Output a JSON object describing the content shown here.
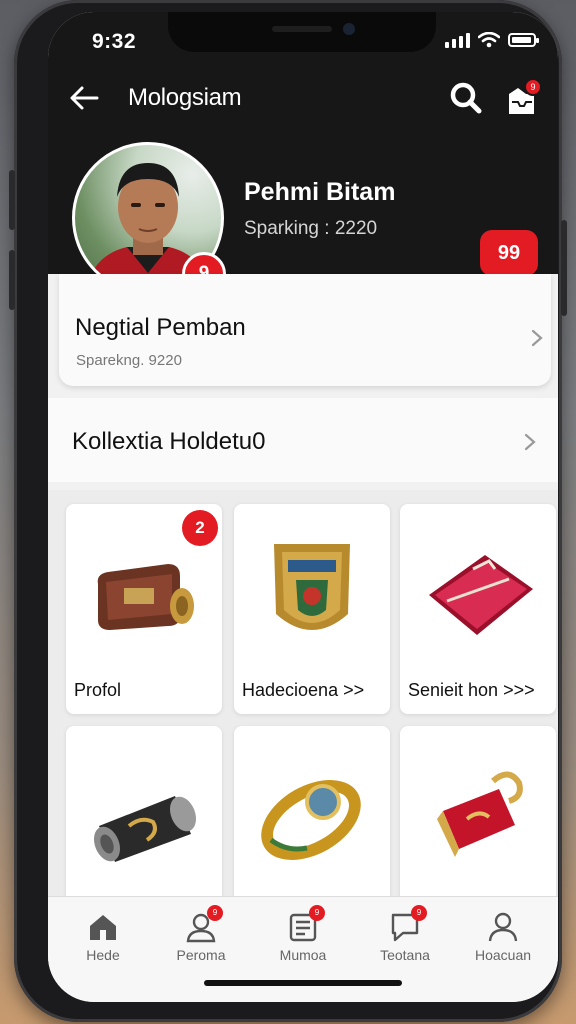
{
  "status_bar": {
    "time": "9:32"
  },
  "header": {
    "title": "Mologsiam",
    "inbox_badge": "9"
  },
  "profile": {
    "name": "Pehmi Bitam",
    "subtitle": "Sparking : 2220",
    "avatar_badge": "9",
    "count_badge": "99"
  },
  "card": {
    "title": "Negtial Pemban",
    "subtitle": "Sparekng. 9220"
  },
  "section": {
    "title": "Kollextia Holdetu0"
  },
  "items": [
    {
      "label": "Profol",
      "badge": "2",
      "icon": "wallet-icon"
    },
    {
      "label": "Hadecioena >>",
      "icon": "badge-shield-icon"
    },
    {
      "label": "Senieit hon >>>",
      "icon": "red-pouch-icon"
    },
    {
      "label": "",
      "icon": "cylinder-icon"
    },
    {
      "label": "",
      "icon": "ring-icon"
    },
    {
      "label": "",
      "icon": "red-padlock-icon"
    }
  ],
  "tabs": [
    {
      "label": "Hede",
      "icon": "home-icon",
      "badge": ""
    },
    {
      "label": "Peroma",
      "icon": "person-icon",
      "badge": "9"
    },
    {
      "label": "Mumoa",
      "icon": "list-icon",
      "badge": "9"
    },
    {
      "label": "Teotana",
      "icon": "chat-icon",
      "badge": "9"
    },
    {
      "label": "Hoacuan",
      "icon": "user-icon",
      "badge": ""
    }
  ],
  "colors": {
    "accent": "#e31b23",
    "dark_header": "#171717",
    "background": "#f1f1f1"
  }
}
